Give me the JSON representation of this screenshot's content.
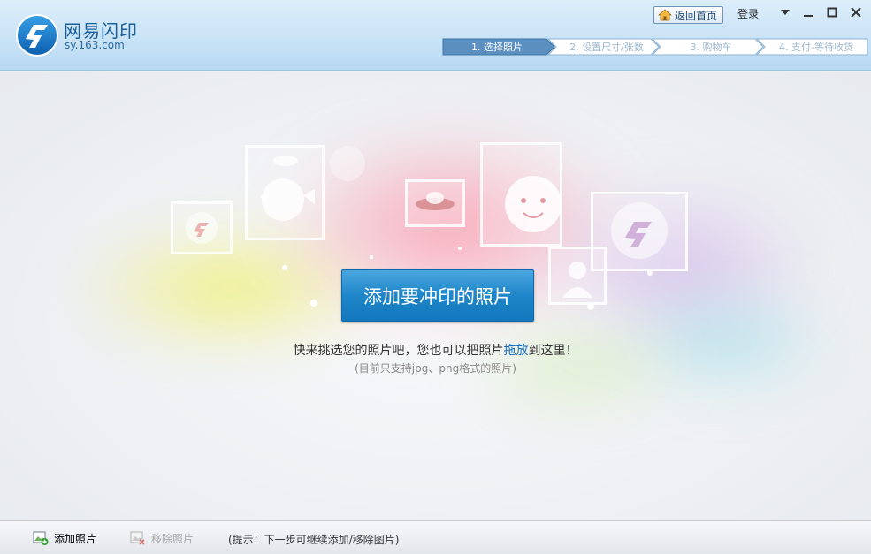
{
  "app": {
    "name": "网易闪印",
    "domain": "sy.163.com"
  },
  "header": {
    "home_label": "返回首页",
    "login_label": "登录"
  },
  "steps": [
    {
      "label": "1. 选择照片",
      "active": true
    },
    {
      "label": "2. 设置尺寸/张数",
      "active": false
    },
    {
      "label": "3. 购物车",
      "active": false
    },
    {
      "label": "4. 支付-等待收货",
      "active": false
    }
  ],
  "main": {
    "add_button_label": "添加要冲印的照片",
    "hint_before": "快来挑选您的照片吧，您也可以把照片",
    "hint_drag": "拖放",
    "hint_after": "到这里！",
    "hint_sub": "(目前只支持jpg、png格式的照片)"
  },
  "footer": {
    "add_label": "添加照片",
    "remove_label": "移除照片",
    "tip": "(提示：下一步可继续添加/移除图片)"
  },
  "colors": {
    "accent": "#1f86c9",
    "header_bg": "#c9e3f6",
    "step_active": "#5b8fc0",
    "link": "#1b6fbf"
  }
}
